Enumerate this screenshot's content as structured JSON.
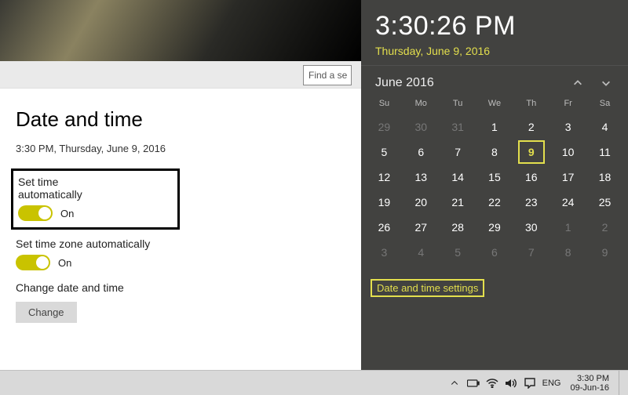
{
  "settings": {
    "title": "Date and time",
    "now_line": "3:30 PM, Thursday, June 9, 2016",
    "search_placeholder": "Find a se",
    "auto_time": {
      "label": "Set time automatically",
      "state": "On"
    },
    "auto_zone": {
      "label": "Set time zone automatically",
      "state": "On"
    },
    "change_dt": {
      "label": "Change date and time",
      "button": "Change"
    }
  },
  "flyout": {
    "time": "3:30:26 PM",
    "date": "Thursday, June 9, 2016",
    "month_label": "June 2016",
    "link": "Date and time settings",
    "dow": [
      "Su",
      "Mo",
      "Tu",
      "We",
      "Th",
      "Fr",
      "Sa"
    ],
    "weeks": [
      [
        {
          "n": "29",
          "k": "dim"
        },
        {
          "n": "30",
          "k": "dim"
        },
        {
          "n": "31",
          "k": "dim"
        },
        {
          "n": "1",
          "k": "cur"
        },
        {
          "n": "2",
          "k": "cur"
        },
        {
          "n": "3",
          "k": "cur"
        },
        {
          "n": "4",
          "k": "cur"
        }
      ],
      [
        {
          "n": "5",
          "k": "cur"
        },
        {
          "n": "6",
          "k": "cur"
        },
        {
          "n": "7",
          "k": "cur"
        },
        {
          "n": "8",
          "k": "cur"
        },
        {
          "n": "9",
          "k": "cur",
          "today": true
        },
        {
          "n": "10",
          "k": "cur"
        },
        {
          "n": "11",
          "k": "cur"
        }
      ],
      [
        {
          "n": "12",
          "k": "cur"
        },
        {
          "n": "13",
          "k": "cur"
        },
        {
          "n": "14",
          "k": "cur"
        },
        {
          "n": "15",
          "k": "cur"
        },
        {
          "n": "16",
          "k": "cur"
        },
        {
          "n": "17",
          "k": "cur"
        },
        {
          "n": "18",
          "k": "cur"
        }
      ],
      [
        {
          "n": "19",
          "k": "cur"
        },
        {
          "n": "20",
          "k": "cur"
        },
        {
          "n": "21",
          "k": "cur"
        },
        {
          "n": "22",
          "k": "cur"
        },
        {
          "n": "23",
          "k": "cur"
        },
        {
          "n": "24",
          "k": "cur"
        },
        {
          "n": "25",
          "k": "cur"
        }
      ],
      [
        {
          "n": "26",
          "k": "cur"
        },
        {
          "n": "27",
          "k": "cur"
        },
        {
          "n": "28",
          "k": "cur"
        },
        {
          "n": "29",
          "k": "cur"
        },
        {
          "n": "30",
          "k": "cur"
        },
        {
          "n": "1",
          "k": "dim"
        },
        {
          "n": "2",
          "k": "dim"
        }
      ],
      [
        {
          "n": "3",
          "k": "dim"
        },
        {
          "n": "4",
          "k": "dim"
        },
        {
          "n": "5",
          "k": "dim"
        },
        {
          "n": "6",
          "k": "dim"
        },
        {
          "n": "7",
          "k": "dim"
        },
        {
          "n": "8",
          "k": "dim"
        },
        {
          "n": "9",
          "k": "dim"
        }
      ]
    ]
  },
  "tray": {
    "lang": "ENG",
    "clock_time": "3:30 PM",
    "clock_date": "09-Jun-16"
  }
}
